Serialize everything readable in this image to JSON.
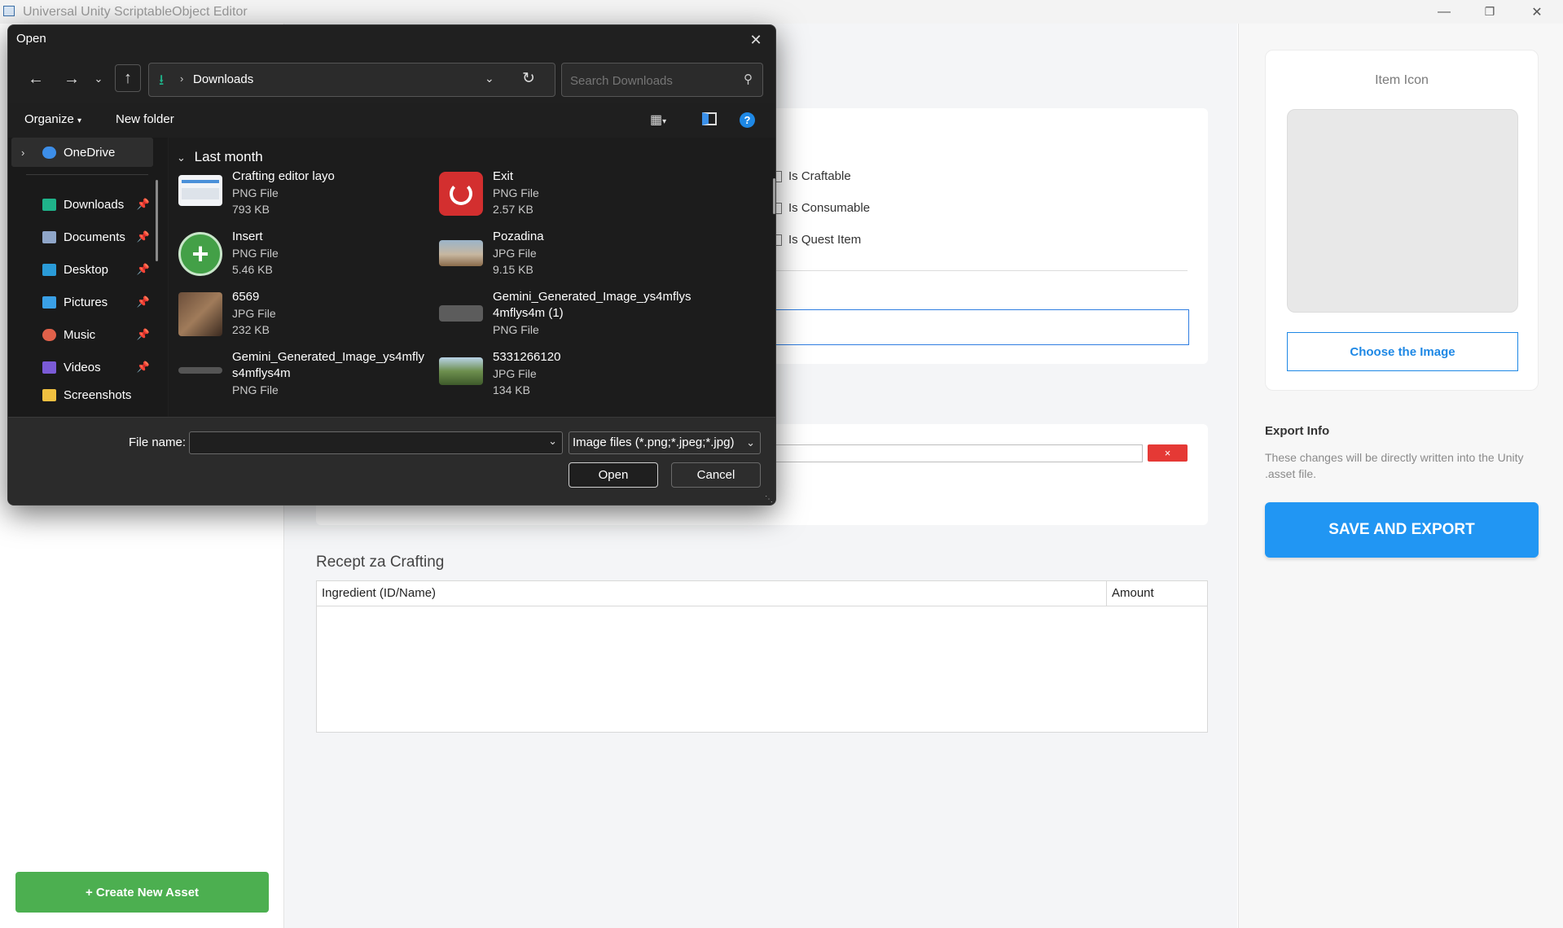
{
  "window": {
    "title": "Universal Unity ScriptableObject Editor"
  },
  "properties": {
    "checkboxes": [
      "Is Craftable",
      "Is Consumable",
      "Is Quest Item"
    ]
  },
  "stats": {
    "remove_label": "×"
  },
  "recipe": {
    "title": "Recept za Crafting",
    "columns": [
      "Ingredient (ID/Name)",
      "Amount"
    ]
  },
  "sidebar": {
    "create_label": "+ Create New Asset"
  },
  "icon_panel": {
    "label": "Item Icon",
    "choose_label": "Choose the Image"
  },
  "export": {
    "title": "Export Info",
    "description": "These changes will be directly written into the Unity .asset file.",
    "save_label": "SAVE AND EXPORT"
  },
  "dialog": {
    "title": "Open",
    "path": "Downloads",
    "search_placeholder": "Search Downloads",
    "toolbar": {
      "organize": "Organize",
      "new_folder": "New folder"
    },
    "nav": [
      {
        "label": "OneDrive",
        "icon": "onedrive-icon",
        "color": "#3d8ee8"
      },
      {
        "label": "Downloads",
        "icon": "downloads-icon",
        "color": "#1fb38a"
      },
      {
        "label": "Documents",
        "icon": "documents-icon",
        "color": "#8fa6c9"
      },
      {
        "label": "Desktop",
        "icon": "desktop-icon",
        "color": "#2a9bd8"
      },
      {
        "label": "Pictures",
        "icon": "pictures-icon",
        "color": "#3aa0e6"
      },
      {
        "label": "Music",
        "icon": "music-icon",
        "color": "#e0614a"
      },
      {
        "label": "Videos",
        "icon": "videos-icon",
        "color": "#7b5bd6"
      },
      {
        "label": "Screenshots",
        "icon": "folder-icon",
        "color": "#f0c040"
      }
    ],
    "group": "Last month",
    "files": [
      {
        "name": "Crafting editor layo",
        "type": "PNG File",
        "size": "793 KB"
      },
      {
        "name": "Exit",
        "type": "PNG File",
        "size": "2.57 KB"
      },
      {
        "name": "Insert",
        "type": "PNG File",
        "size": "5.46 KB"
      },
      {
        "name": "Pozadina",
        "type": "JPG File",
        "size": "9.15 KB"
      },
      {
        "name": "6569",
        "type": "JPG File",
        "size": "232 KB"
      },
      {
        "name": "Gemini_Generated_Image_ys4mflys4mflys4m (1)",
        "type": "PNG File",
        "size": ""
      },
      {
        "name": "Gemini_Generated_Image_ys4mflys4mflys4m",
        "type": "PNG File",
        "size": ""
      },
      {
        "name": "5331266120",
        "type": "JPG File",
        "size": "134 KB"
      }
    ],
    "file_name_label": "File name:",
    "file_name_value": "",
    "filter": "Image files (*.png;*.jpeg;*.jpg)",
    "open_label": "Open",
    "cancel_label": "Cancel"
  }
}
